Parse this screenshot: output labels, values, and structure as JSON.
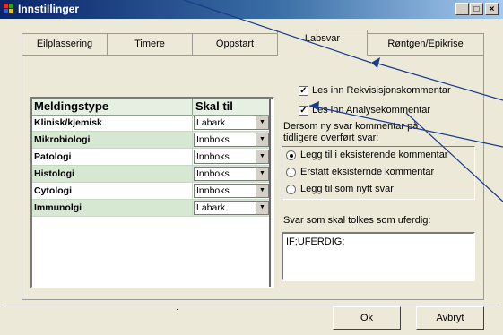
{
  "window": {
    "title": "Innstillinger",
    "minimize": "_",
    "maximize": "□",
    "close": "×"
  },
  "tabs": [
    {
      "label": "Eilplassering"
    },
    {
      "label": "Timere"
    },
    {
      "label": "Oppstart"
    },
    {
      "label": "Labsvar",
      "active": true
    },
    {
      "label": "Røntgen/Epikrise"
    }
  ],
  "grid": {
    "col1_header": "Meldingstype",
    "col2_header": "Skal til",
    "rows": [
      {
        "type": "Klinisk/kjemisk",
        "dest": "Labark"
      },
      {
        "type": "Mikrobiologi",
        "dest": "Innboks"
      },
      {
        "type": "Patologi",
        "dest": "Innboks"
      },
      {
        "type": "Histologi",
        "dest": "Innboks"
      },
      {
        "type": "Cytologi",
        "dest": "Innboks"
      },
      {
        "type": "Immunolgi",
        "dest": "Labark"
      }
    ]
  },
  "options": {
    "cb1_label": "Les inn Rekvisisjonskommentar",
    "cb1_checked": true,
    "cb2_label": "Les inn Analysekommentar",
    "cb2_checked": true,
    "dersom_line1": "Dersom ny svar kommentar på",
    "dersom_line2": "tidligere overført svar:"
  },
  "radios": [
    {
      "label": "Legg til i eksisterende kommentar",
      "selected": true
    },
    {
      "label": "Erstatt eksisternde kommentar",
      "selected": false
    },
    {
      "label": "Legg til som nytt svar",
      "selected": false
    }
  ],
  "svar_label": "Svar som skal tolkes som uferdig:",
  "svar_value": "IF;UFERDIG;",
  "status_dot": "·",
  "buttons": {
    "ok": "Ok",
    "cancel": "Avbryt"
  },
  "colors": {
    "title_start": "#0a246a",
    "title_end": "#a6caf0",
    "grid_alt_row": "#d6e8d2",
    "arrow": "#1a3a8a"
  }
}
